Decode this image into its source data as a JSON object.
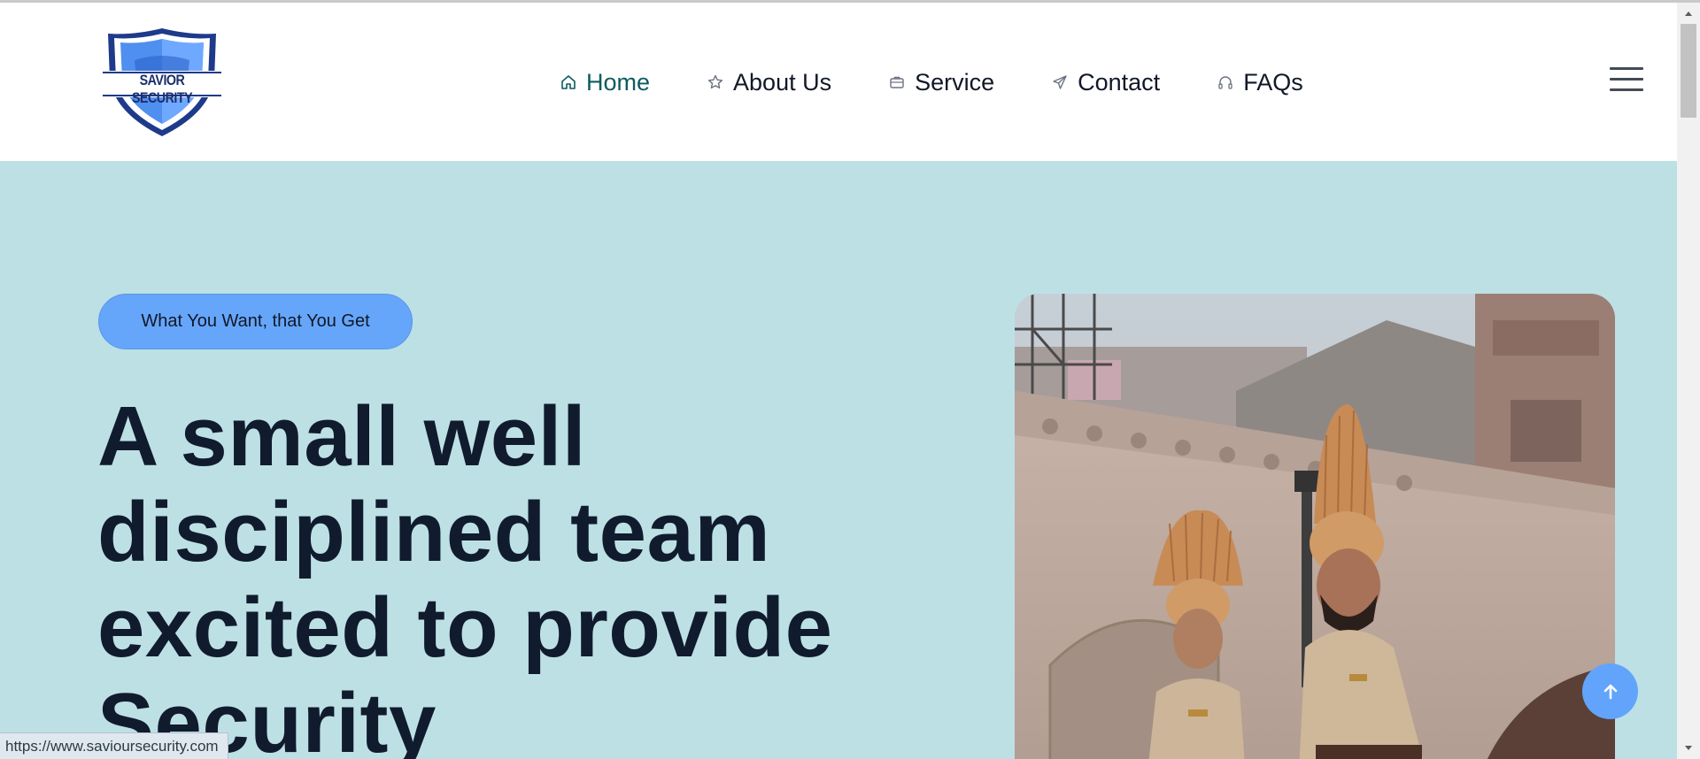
{
  "brand": {
    "logo_text": "SAVIOR SECURITY"
  },
  "nav": {
    "items": [
      {
        "label": "Home",
        "icon": "home-icon",
        "active": true
      },
      {
        "label": "About Us",
        "icon": "star-icon",
        "active": false
      },
      {
        "label": "Service",
        "icon": "briefcase-icon",
        "active": false
      },
      {
        "label": "Contact",
        "icon": "paper-plane-icon",
        "active": false
      },
      {
        "label": "FAQs",
        "icon": "headphones-icon",
        "active": false
      }
    ]
  },
  "hero": {
    "badge": "What You Want, that You Get",
    "headline": "A small well disciplined team excited to provide Security",
    "image": "guards-with-turbans-photo"
  },
  "status_bar": {
    "url": "https://www.savioursecurity.com"
  },
  "colors": {
    "hero_bg": "#bde0e5",
    "badge_bg": "#66a6fa",
    "nav_active": "#0c5b5e",
    "scroll_top_button": "#62a4fb",
    "headline": "#111b2e"
  }
}
